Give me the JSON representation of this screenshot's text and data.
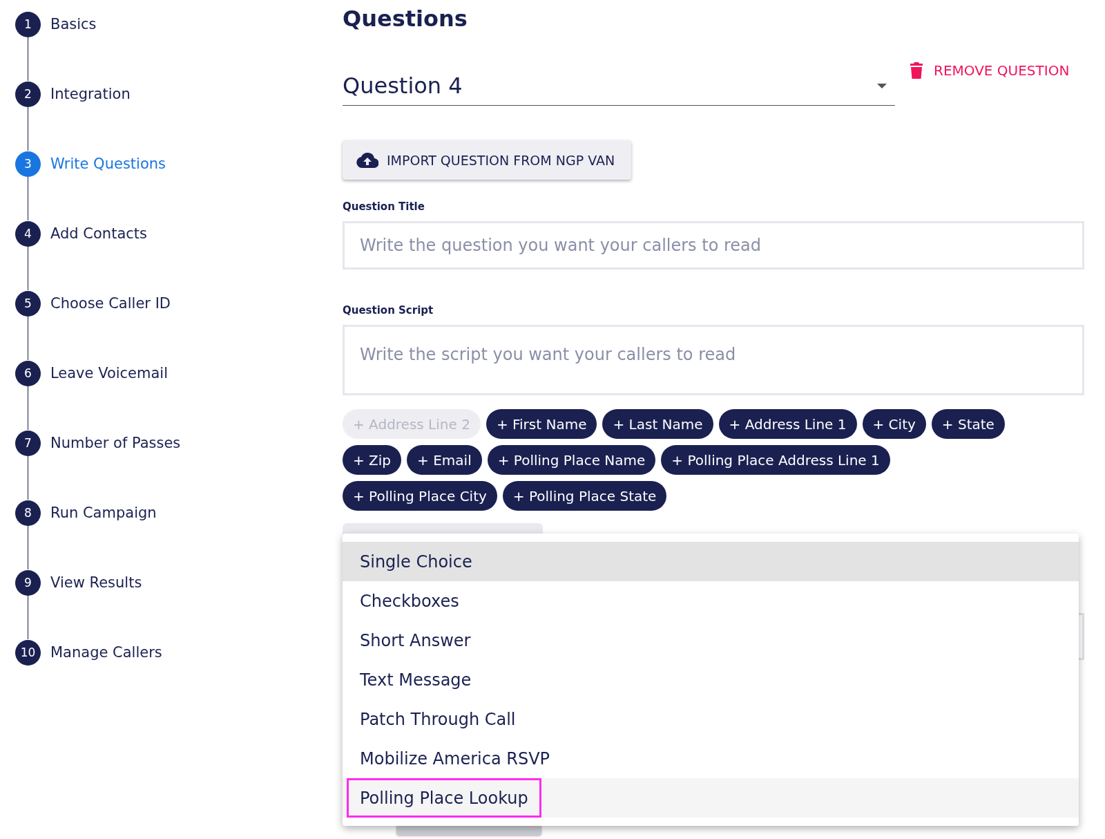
{
  "steps": [
    {
      "number": "1",
      "label": "Basics",
      "selected": false
    },
    {
      "number": "2",
      "label": "Integration",
      "selected": false
    },
    {
      "number": "3",
      "label": "Write Questions",
      "selected": true
    },
    {
      "number": "4",
      "label": "Add Contacts",
      "selected": false
    },
    {
      "number": "5",
      "label": "Choose Caller ID",
      "selected": false
    },
    {
      "number": "6",
      "label": "Leave Voicemail",
      "selected": false
    },
    {
      "number": "7",
      "label": "Number of Passes",
      "selected": false
    },
    {
      "number": "8",
      "label": "Run Campaign",
      "selected": false
    },
    {
      "number": "9",
      "label": "View Results",
      "selected": false
    },
    {
      "number": "10",
      "label": "Manage Callers",
      "selected": false
    }
  ],
  "title": "Questions",
  "question_select": {
    "value": "Question 4"
  },
  "remove_button": "REMOVE QUESTION",
  "import_button": "IMPORT QUESTION FROM NGP VAN",
  "question_title": {
    "label": "Question Title",
    "placeholder": "Write the question you want your callers to read"
  },
  "question_script": {
    "label": "Question Script",
    "placeholder": "Write the script you want your callers to read"
  },
  "fields": [
    {
      "label": "+ Address Line 2",
      "disabled": true
    },
    {
      "label": "+ First Name",
      "disabled": false
    },
    {
      "label": "+ Last Name",
      "disabled": false
    },
    {
      "label": "+ Address Line 1",
      "disabled": false
    },
    {
      "label": "+ City",
      "disabled": false
    },
    {
      "label": "+ State",
      "disabled": false
    },
    {
      "label": "+ Zip",
      "disabled": false
    },
    {
      "label": "+ Email",
      "disabled": false
    },
    {
      "label": "+ Polling Place Name",
      "disabled": false
    },
    {
      "label": "+ Polling Place Address Line 1",
      "disabled": false
    },
    {
      "label": "+ Polling Place City",
      "disabled": false
    },
    {
      "label": "+ Polling Place State",
      "disabled": false
    }
  ],
  "type_menu": [
    {
      "label": "Single Choice",
      "selected": true,
      "highlighted": false
    },
    {
      "label": "Checkboxes",
      "selected": false,
      "highlighted": false
    },
    {
      "label": "Short Answer",
      "selected": false,
      "highlighted": false
    },
    {
      "label": "Text Message",
      "selected": false,
      "highlighted": false
    },
    {
      "label": "Patch Through Call",
      "selected": false,
      "highlighted": false
    },
    {
      "label": "Mobilize America RSVP",
      "selected": false,
      "highlighted": false
    },
    {
      "label": "Polling Place Lookup",
      "selected": false,
      "highlighted": true
    }
  ]
}
